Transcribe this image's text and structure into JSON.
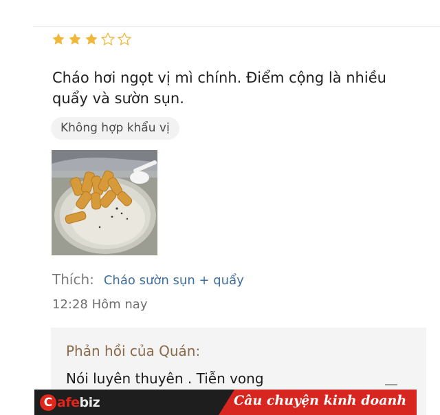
{
  "review": {
    "rating": 3,
    "rating_max": 5,
    "star_color": "#f0b83a",
    "text_line1": "Cháo hơi ngọt vị mì chính. Điểm cộng là nhiều",
    "text_line2": "quẩy và sườn sụn.",
    "tag": "Không hợp khẩu vị",
    "like_label": "Thích:",
    "like_item": "Cháo sườn sụn + quẩy",
    "timestamp": "12:28 Hôm nay"
  },
  "reply": {
    "title": "Phản hồi của Quán:",
    "text": "Nói luyên thuyên . Tiễn vong"
  },
  "footer": {
    "brand_c": "C",
    "brand_a": "afe",
    "brand_b": "biz",
    "slogan": "Câu chuyện kinh doanh",
    "brand_color": "#e1261c"
  }
}
